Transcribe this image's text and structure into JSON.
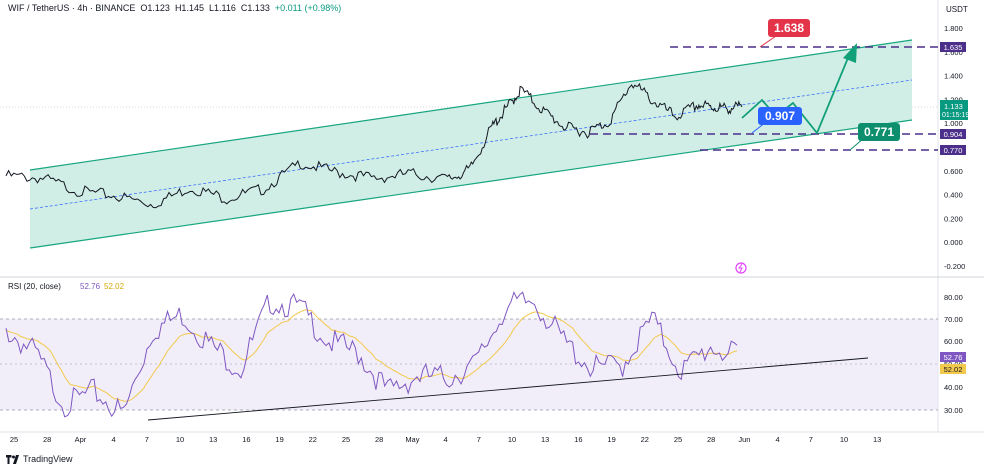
{
  "header": {
    "symbol": "WIF / TetherUS · 4h · BINANCE",
    "open": "O1.123",
    "high": "H1.145",
    "low": "L1.116",
    "close": "C1.133",
    "change": "+0.011 (+0.98%)"
  },
  "currency_label": "USDT",
  "price_axis": [
    "1.800",
    "1.600",
    "1.400",
    "1.200",
    "1.000",
    "0.800",
    "0.600",
    "0.400",
    "0.200",
    "0.000",
    "-0.200"
  ],
  "price_markers": {
    "target_high": "1.635",
    "current": "1.133",
    "countdown": "01:15:19",
    "support_mid": "0.904",
    "support_low": "0.770"
  },
  "callouts": {
    "target": "1.638",
    "mid": "0.907",
    "low": "0.771"
  },
  "rsi": {
    "label": "RSI (20, close)",
    "value": "52.76",
    "ma": "52.02",
    "axis": [
      "80.00",
      "70.00",
      "60.00",
      "50.00",
      "40.00",
      "30.00"
    ]
  },
  "time_axis": [
    "25",
    "28",
    "Apr",
    "4",
    "7",
    "10",
    "13",
    "16",
    "19",
    "22",
    "25",
    "28",
    "May",
    "4",
    "7",
    "10",
    "13",
    "16",
    "19",
    "22",
    "25",
    "28",
    "Jun",
    "4",
    "7",
    "10",
    "13"
  ],
  "footer": "TradingView",
  "colors": {
    "channel_fill": "#c9ebe2",
    "channel_line": "#17a67f",
    "projection": "#12a07a",
    "dash_purple": "#4b2f8a",
    "callout_red": "#e3344a",
    "callout_blue": "#2962ff",
    "callout_green": "#0d8f6e",
    "rsi_line": "#7e57c2",
    "rsi_ma": "#f2c94c",
    "rsi_band": "#ede7f6"
  },
  "chart_data": {
    "type": "line",
    "price_range": [
      -0.2,
      1.8
    ],
    "rsi_range": [
      25,
      85
    ],
    "price_series": {
      "x": [
        0,
        5,
        10,
        15,
        20,
        25,
        30,
        35,
        40,
        45,
        50,
        55,
        60,
        63,
        66,
        68,
        70,
        73,
        76,
        79,
        82,
        85,
        88,
        91,
        94,
        96,
        98,
        100
      ],
      "y": [
        0.55,
        0.53,
        0.42,
        0.38,
        0.31,
        0.45,
        0.36,
        0.44,
        0.66,
        0.58,
        0.53,
        0.57,
        0.52,
        0.6,
        0.96,
        1.12,
        1.28,
        1.1,
        0.96,
        0.92,
        1.01,
        1.34,
        1.18,
        1.05,
        1.15,
        1.13,
        1.12,
        1.133
      ]
    },
    "rsi_series": {
      "x": [
        0,
        4,
        8,
        12,
        16,
        20,
        24,
        28,
        32,
        36,
        40,
        44,
        48,
        52,
        56,
        60,
        64,
        68,
        72,
        76,
        80,
        84,
        88,
        92,
        96,
        100
      ],
      "y": [
        65,
        55,
        32,
        38,
        28,
        65,
        72,
        58,
        48,
        78,
        75,
        60,
        55,
        38,
        45,
        44,
        50,
        75,
        78,
        60,
        48,
        50,
        70,
        47,
        58,
        52.76
      ]
    },
    "projection": [
      1.133,
      1.0,
      0.907,
      0.771,
      1.638
    ]
  }
}
